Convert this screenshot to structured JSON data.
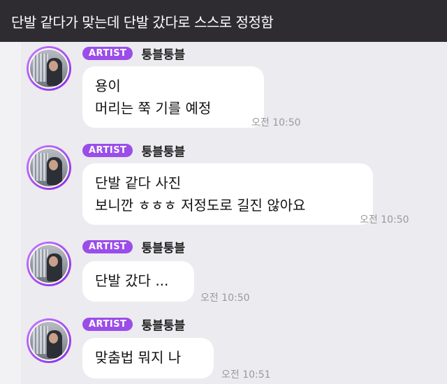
{
  "title": "단발 같다가 맞는데 단발 갔다로 스스로 정정함",
  "messages": [
    {
      "badge": "ARTIST",
      "sender": "퉁블퉁블",
      "lines": [
        "용이",
        "머리는 쭉 기를 예정"
      ],
      "time": "오전 10:50"
    },
    {
      "badge": "ARTIST",
      "sender": "퉁블퉁블",
      "lines": [
        "단발 같다 사진",
        "보니깐 ㅎㅎㅎ 저정도로 길진 않아요"
      ],
      "time": "오전 10:50"
    },
    {
      "badge": "ARTIST",
      "sender": "퉁블퉁블",
      "lines": [
        "단발 갔다 ..."
      ],
      "time": "오전 10:50"
    },
    {
      "badge": "ARTIST",
      "sender": "퉁블퉁블",
      "lines": [
        "맞춤법 뭐지 나"
      ],
      "time": "오전 10:51"
    }
  ],
  "colors": {
    "title_bar": "#2e2c30",
    "chat_background": "#ecebef",
    "badge": "#9b4dea",
    "bubble": "#ffffff",
    "timestamp": "#9a9a9e"
  },
  "icons": {
    "avatar": "artist-profile-photo"
  }
}
